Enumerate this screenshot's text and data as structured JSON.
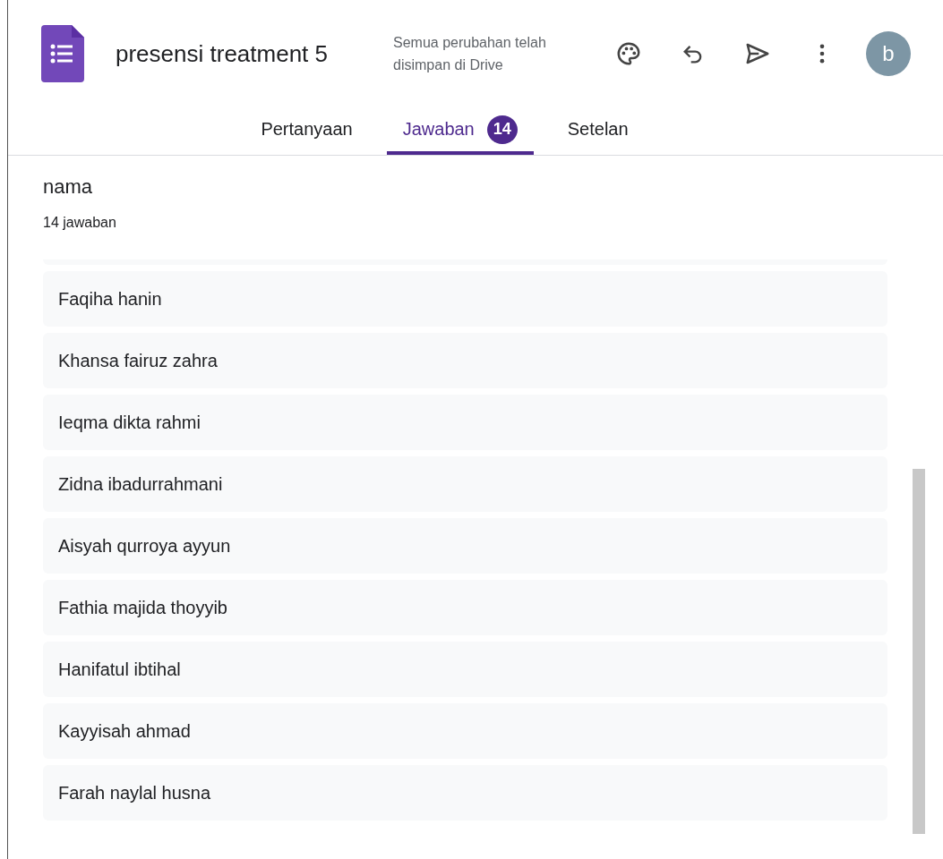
{
  "header": {
    "title": "presensi treatment 5",
    "save_status": "Semua perubahan telah disimpan di Drive",
    "avatar": "b"
  },
  "tabs": [
    {
      "label": "Pertanyaan",
      "selected": false
    },
    {
      "label": "Jawaban",
      "selected": true,
      "badge": "14"
    },
    {
      "label": "Setelan",
      "selected": false
    }
  ],
  "question": {
    "title": "nama",
    "count": "14 jawaban"
  },
  "answers": [
    "Faqiha hanin",
    "Khansa fairuz zahra",
    "Ieqma dikta rahmi",
    "Zidna ibadurrahmani",
    "Aisyah qurroya ayyun",
    "Fathia majida thoyyib",
    "Hanifatul ibtihal",
    "Kayyisah ahmad",
    "Farah naylal husna"
  ]
}
